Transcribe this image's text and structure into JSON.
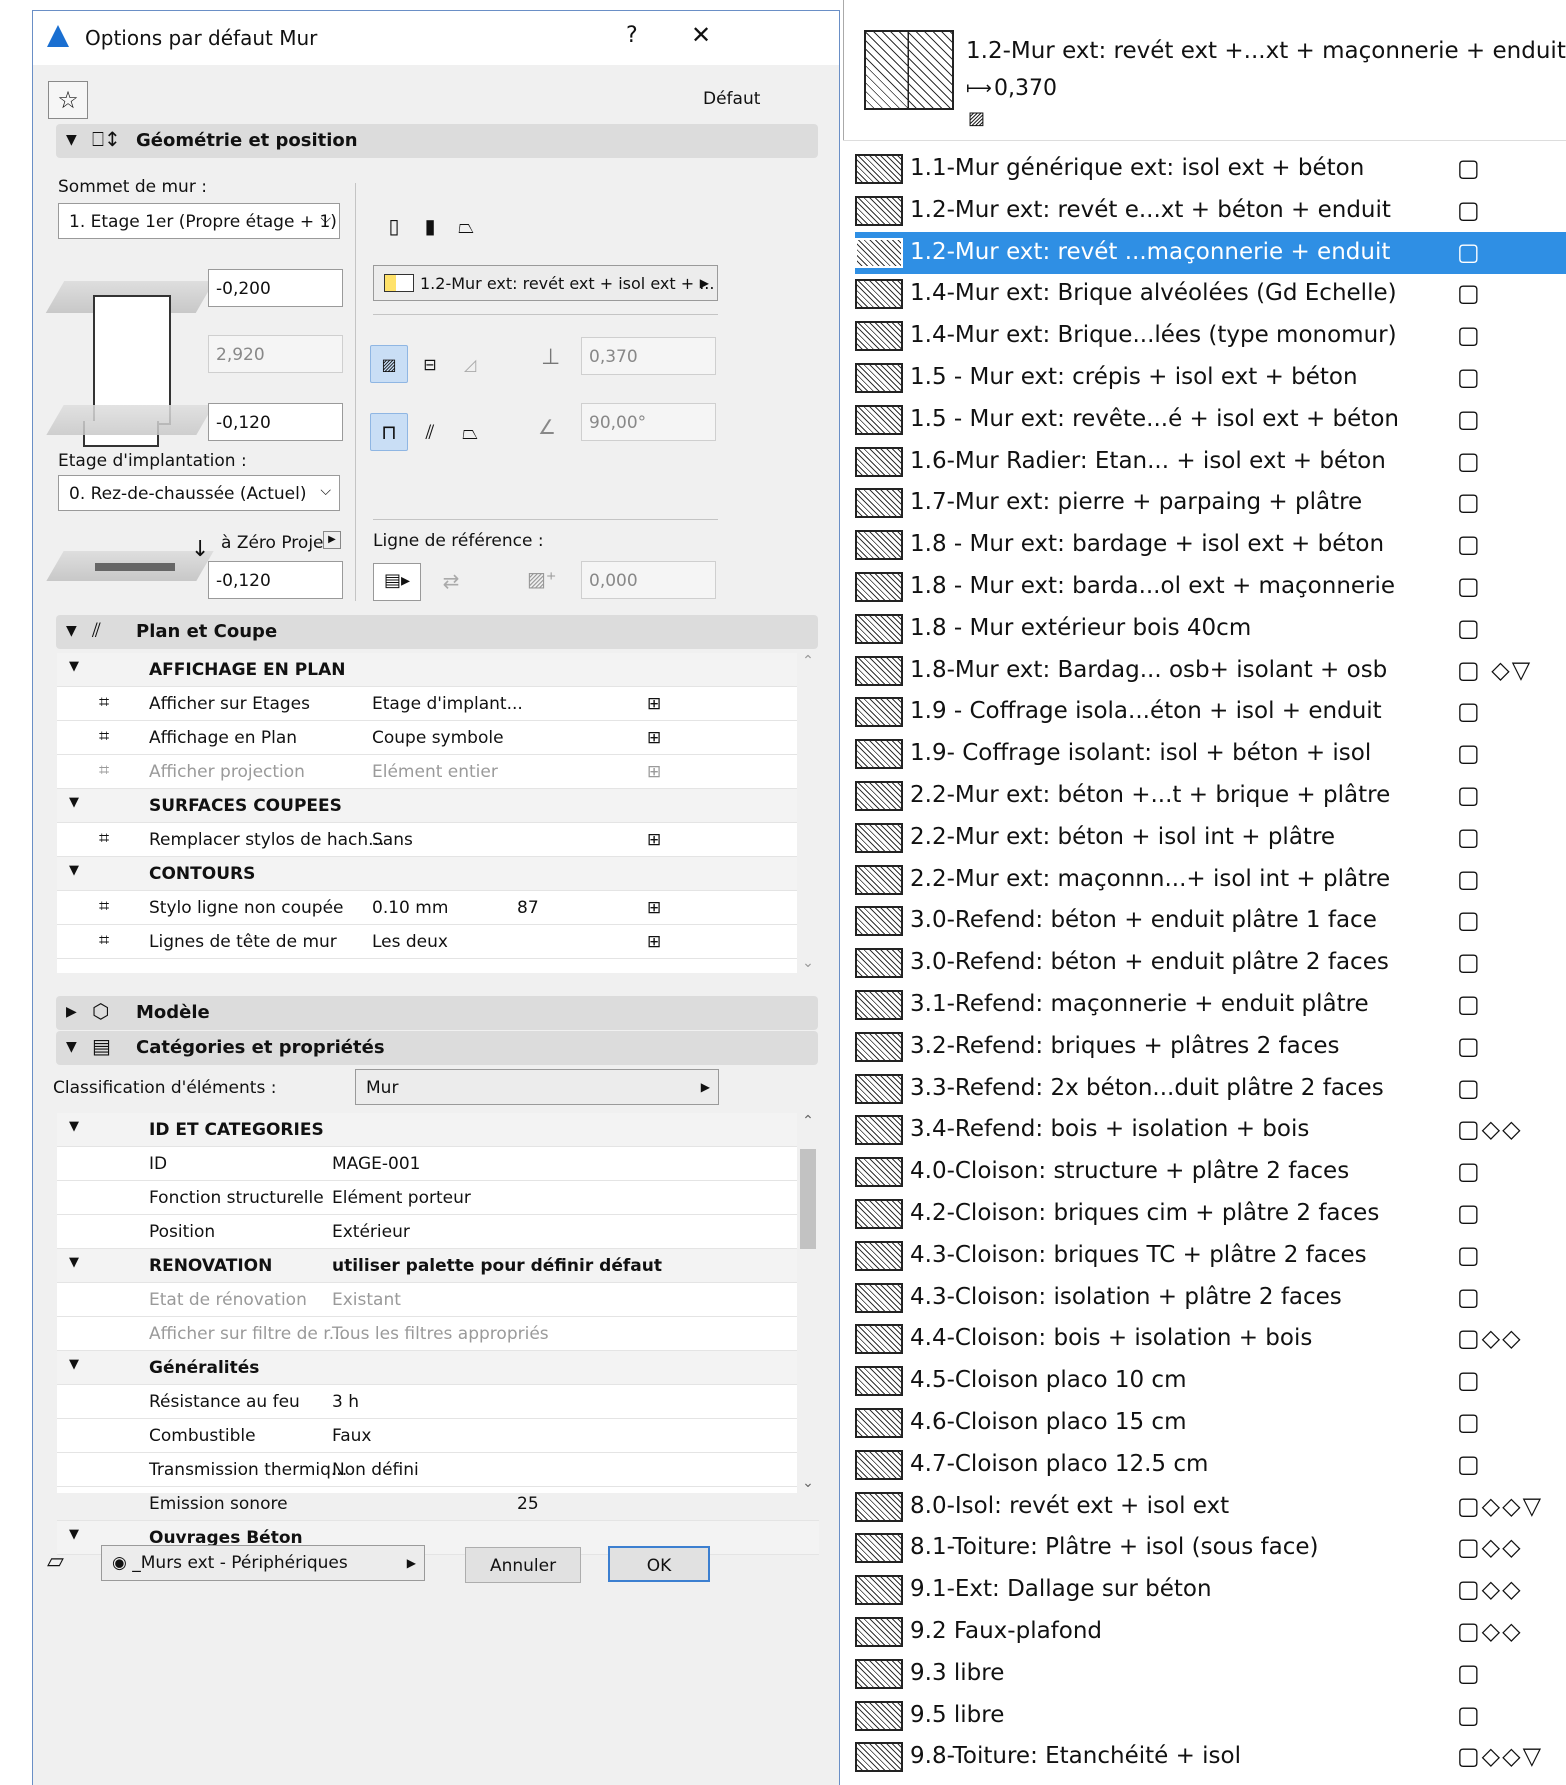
{
  "dialog": {
    "title": "Options par défaut Mur",
    "help": "?",
    "close": "✕",
    "favorite_icon": "star-icon",
    "default_label": "Défaut",
    "sections": {
      "geometry": "Géométrie et position",
      "plan": "Plan et Coupe",
      "model": "Modèle",
      "categories": "Catégories et propriétés"
    },
    "geometry": {
      "top_label": "Sommet de mur :",
      "top_value": "1. Etage 1er (Propre étage + 1)",
      "offset_top": "-0,200",
      "height": "2,920",
      "offset_bottom": "-0,120",
      "home_story_label": "Etage d'implantation :",
      "home_story_value": "0. Rez-de-chaussée (Actuel)",
      "zero_label": "à Zéro Projet",
      "zero_value": "-0,120",
      "composite": "1.2-Mur ext: revét ext + isol ext + ...",
      "thickness": "0,370",
      "angle": "90,00°",
      "ref_line_label": "Ligne de référence :",
      "ref_offset": "0,000"
    },
    "plan": {
      "rows": [
        {
          "kind": "group",
          "label": "AFFICHAGE EN PLAN"
        },
        {
          "kind": "item",
          "label": "Afficher sur Etages",
          "value": "Etage d'implant...",
          "icon": "story-icon"
        },
        {
          "kind": "item",
          "label": "Affichage en Plan",
          "value": "Coupe symbole",
          "icon": "plan-display-icon"
        },
        {
          "kind": "dim",
          "label": "Afficher projection",
          "value": "Elément entier",
          "icon": "projection-icon"
        },
        {
          "kind": "group",
          "label": "SURFACES COUPEES"
        },
        {
          "kind": "item",
          "label": "Remplacer stylos de hach...",
          "value": "Sans",
          "icon": "pen-override-icon"
        },
        {
          "kind": "group",
          "label": "CONTOURS"
        },
        {
          "kind": "item",
          "label": "Stylo ligne non coupée",
          "value": "0.10 mm",
          "extra": "87",
          "icon": "pen-line-icon"
        },
        {
          "kind": "item",
          "label": "Lignes de tête de mur",
          "value": "Les deux",
          "icon": "wall-end-icon"
        }
      ]
    },
    "classification_label": "Classification d'éléments :",
    "classification_value": "Mur",
    "props": {
      "rows": [
        {
          "kind": "group",
          "label": "ID ET CATEGORIES"
        },
        {
          "kind": "item",
          "label": "ID",
          "value": "MAGE-001"
        },
        {
          "kind": "item",
          "label": "Fonction structurelle",
          "value": "Elément porteur"
        },
        {
          "kind": "item",
          "label": "Position",
          "value": "Extérieur"
        },
        {
          "kind": "group",
          "label": "RENOVATION",
          "value": "utiliser palette pour définir défaut"
        },
        {
          "kind": "dim",
          "label": "Etat de rénovation",
          "value": "Existant"
        },
        {
          "kind": "dim",
          "label": "Afficher sur filtre de r...",
          "value": "Tous les filtres appropriés"
        },
        {
          "kind": "group",
          "label": "Généralités"
        },
        {
          "kind": "item",
          "label": "Résistance au feu",
          "value": "3 h"
        },
        {
          "kind": "item",
          "label": "Combustible",
          "value": "Faux"
        },
        {
          "kind": "item",
          "label": "Transmission thermiq...",
          "value": "Non défini"
        },
        {
          "kind": "item",
          "label": "Emission sonore",
          "value": "",
          "extra": "25"
        },
        {
          "kind": "group",
          "label": "Ouvrages Béton"
        }
      ]
    },
    "layer": "_Murs ext - Périphériques",
    "cancel": "Annuler",
    "ok": "OK"
  },
  "preview": {
    "name": "1.2-Mur ext: revét ext +...xt + maçonnerie + enduit",
    "thickness": "0,370"
  },
  "list": [
    {
      "name": "1.1-Mur générique ext: isol ext + béton",
      "flags": "▢"
    },
    {
      "name": "1.2-Mur ext: revét e...xt + béton + enduit",
      "flags": "▢"
    },
    {
      "name": "1.2-Mur ext: revét ...maçonnerie + enduit",
      "flags": "▢",
      "selected": true
    },
    {
      "name": "1.4-Mur ext: Brique alvéolées (Gd Echelle)",
      "flags": "▢"
    },
    {
      "name": "1.4-Mur ext: Brique...lées (type monomur)",
      "flags": "▢"
    },
    {
      "name": "1.5 - Mur ext: crépis + isol ext + béton",
      "flags": "▢"
    },
    {
      "name": "1.5 - Mur ext: revête...é + isol ext + béton",
      "flags": "▢"
    },
    {
      "name": "1.6-Mur Radier: Etan... + isol ext + béton",
      "flags": "▢"
    },
    {
      "name": "1.7-Mur ext: pierre + parpaing + plâtre",
      "flags": "▢"
    },
    {
      "name": "1.8 - Mur ext: bardage + isol ext + béton",
      "flags": "▢"
    },
    {
      "name": "1.8 - Mur ext: barda...ol ext + maçonnerie",
      "flags": "▢"
    },
    {
      "name": "1.8 - Mur extérieur bois 40cm",
      "flags": "▢"
    },
    {
      "name": "1.8-Mur ext: Bardag... osb+ isolant + osb",
      "flags": "▢ ◇▽"
    },
    {
      "name": "1.9 - Coffrage isola...éton + isol + enduit",
      "flags": "▢"
    },
    {
      "name": "1.9- Coffrage isolant: isol + béton + isol",
      "flags": "▢"
    },
    {
      "name": "2.2-Mur ext: béton +...t + brique + plâtre",
      "flags": "▢"
    },
    {
      "name": "2.2-Mur ext: béton + isol int + plâtre",
      "flags": "▢"
    },
    {
      "name": "2.2-Mur ext: maçonnn...+ isol int + plâtre",
      "flags": "▢"
    },
    {
      "name": "3.0-Refend: béton + enduit plâtre 1 face",
      "flags": "▢"
    },
    {
      "name": "3.0-Refend: béton + enduit plâtre 2 faces",
      "flags": "▢"
    },
    {
      "name": "3.1-Refend: maçonnerie + enduit plâtre",
      "flags": "▢"
    },
    {
      "name": "3.2-Refend: briques + plâtres 2 faces",
      "flags": "▢"
    },
    {
      "name": "3.3-Refend: 2x béton...duit plâtre 2 faces",
      "flags": "▢"
    },
    {
      "name": "3.4-Refend: bois + isolation + bois",
      "flags": "▢◇◇"
    },
    {
      "name": "4.0-Cloison: structure + plâtre 2 faces",
      "flags": "▢"
    },
    {
      "name": "4.2-Cloison: briques cim + plâtre 2 faces",
      "flags": "▢"
    },
    {
      "name": "4.3-Cloison: briques TC + plâtre 2 faces",
      "flags": "▢"
    },
    {
      "name": "4.3-Cloison: isolation + plâtre 2 faces",
      "flags": "▢"
    },
    {
      "name": "4.4-Cloison: bois + isolation + bois",
      "flags": "▢◇◇"
    },
    {
      "name": "4.5-Cloison placo 10 cm",
      "flags": "▢"
    },
    {
      "name": "4.6-Cloison placo 15 cm",
      "flags": "▢"
    },
    {
      "name": "4.7-Cloison placo 12.5 cm",
      "flags": "▢"
    },
    {
      "name": "8.0-Isol: revét ext + isol ext",
      "flags": "▢◇◇▽"
    },
    {
      "name": "8.1-Toiture: Plâtre + isol (sous face)",
      "flags": "▢◇◇"
    },
    {
      "name": "9.1-Ext: Dallage sur béton",
      "flags": "▢◇◇"
    },
    {
      "name": "9.2 Faux-plafond",
      "flags": "▢◇◇"
    },
    {
      "name": "9.3 libre",
      "flags": "▢"
    },
    {
      "name": "9.5 libre",
      "flags": "▢"
    },
    {
      "name": "9.8-Toiture: Etanchéité + isol",
      "flags": "▢◇◇▽"
    }
  ]
}
